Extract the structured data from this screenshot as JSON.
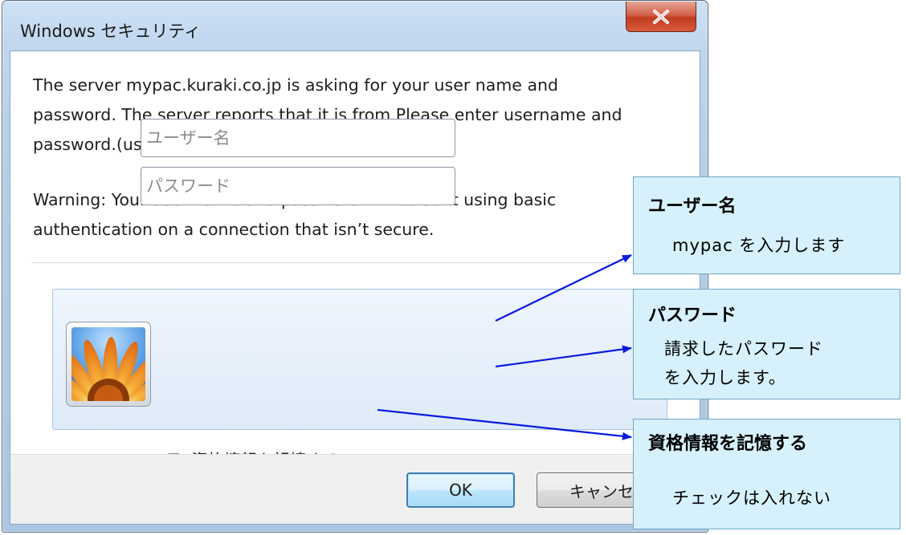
{
  "window": {
    "title": "Windows セキュリティ",
    "close_label": "Close"
  },
  "dialog": {
    "message": "The server mypac.kuraki.co.jp is asking for your user name and password. The server reports that it is from Please enter username and password.(username=mypac).",
    "warning": "Warning: Your user name and password will be sent using basic authentication on a connection that isn’t secure."
  },
  "credentials": {
    "username_placeholder": "ユーザー名",
    "username_value": "",
    "password_placeholder": "パスワード",
    "password_value": "",
    "remember_label": "資格情報を記憶する",
    "remember_checked": false
  },
  "buttons": {
    "ok_label": "OK",
    "cancel_label": "キャンセル"
  },
  "annotations": {
    "username": {
      "title": "ユーザー名",
      "desc": "mypac を入力します"
    },
    "password": {
      "title": "パスワード",
      "desc_line1": "請求したパスワード",
      "desc_line2": "を入力します。"
    },
    "remember": {
      "title": "資格情報を記憶する",
      "desc": "チェックは入れない"
    }
  },
  "colors": {
    "callout_bg": "#d6f1fb",
    "arrow": "#0a1ae0",
    "ok_border": "#3c7fb1",
    "close_button": "#c23c20"
  },
  "icons": {
    "close": "close-x-icon",
    "avatar": "user-tile-flower-icon",
    "checkbox": "checkbox-unchecked"
  }
}
